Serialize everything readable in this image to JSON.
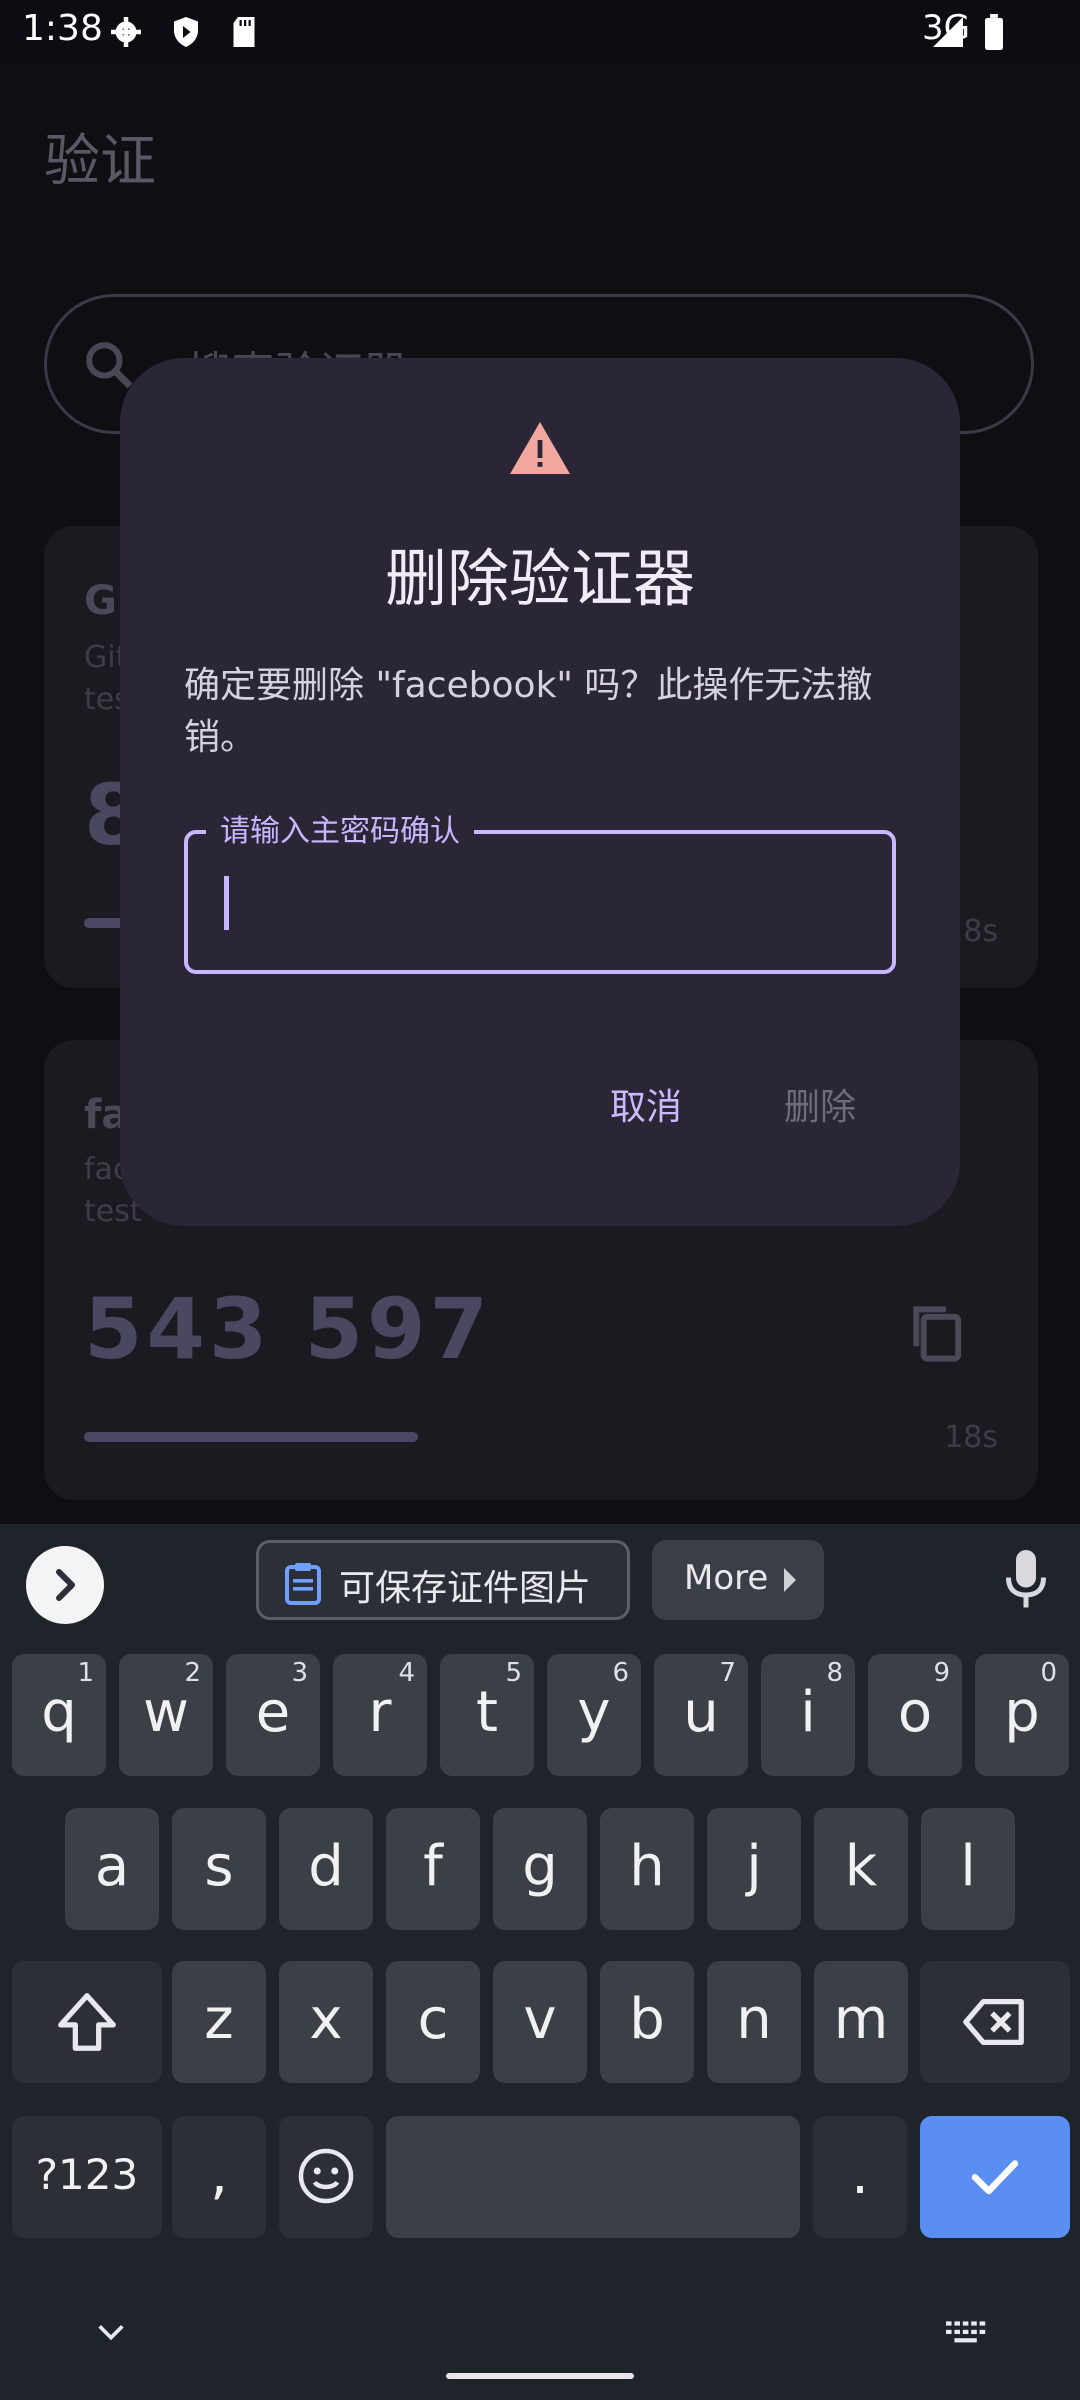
{
  "status": {
    "time": "1:38",
    "network": "3G"
  },
  "app": {
    "title": "验证",
    "search_placeholder": "搜索验证器",
    "cards": [
      {
        "name": "Gi",
        "sub1": "Git",
        "sub2": "tes",
        "code": "8",
        "secs": "18s"
      },
      {
        "name": "fa",
        "sub1": "fac",
        "sub2": "test",
        "code": "543 597",
        "secs": "18s"
      }
    ]
  },
  "dialog": {
    "title": "删除验证器",
    "message": "确定要删除 \"facebook\" 吗？此操作无法撤销。",
    "field_label": "请输入主密码确认",
    "cancel": "取消",
    "delete": "删除"
  },
  "keyboard": {
    "suggestion": "可保存证件图片",
    "more": "More",
    "row1": [
      {
        "k": "q",
        "h": "1"
      },
      {
        "k": "w",
        "h": "2"
      },
      {
        "k": "e",
        "h": "3"
      },
      {
        "k": "r",
        "h": "4"
      },
      {
        "k": "t",
        "h": "5"
      },
      {
        "k": "y",
        "h": "6"
      },
      {
        "k": "u",
        "h": "7"
      },
      {
        "k": "i",
        "h": "8"
      },
      {
        "k": "o",
        "h": "9"
      },
      {
        "k": "p",
        "h": "0"
      }
    ],
    "row2": [
      "a",
      "s",
      "d",
      "f",
      "g",
      "h",
      "j",
      "k",
      "l"
    ],
    "row3": [
      "z",
      "x",
      "c",
      "v",
      "b",
      "n",
      "m"
    ],
    "symbols": "?123",
    "comma": ",",
    "period": "."
  }
}
